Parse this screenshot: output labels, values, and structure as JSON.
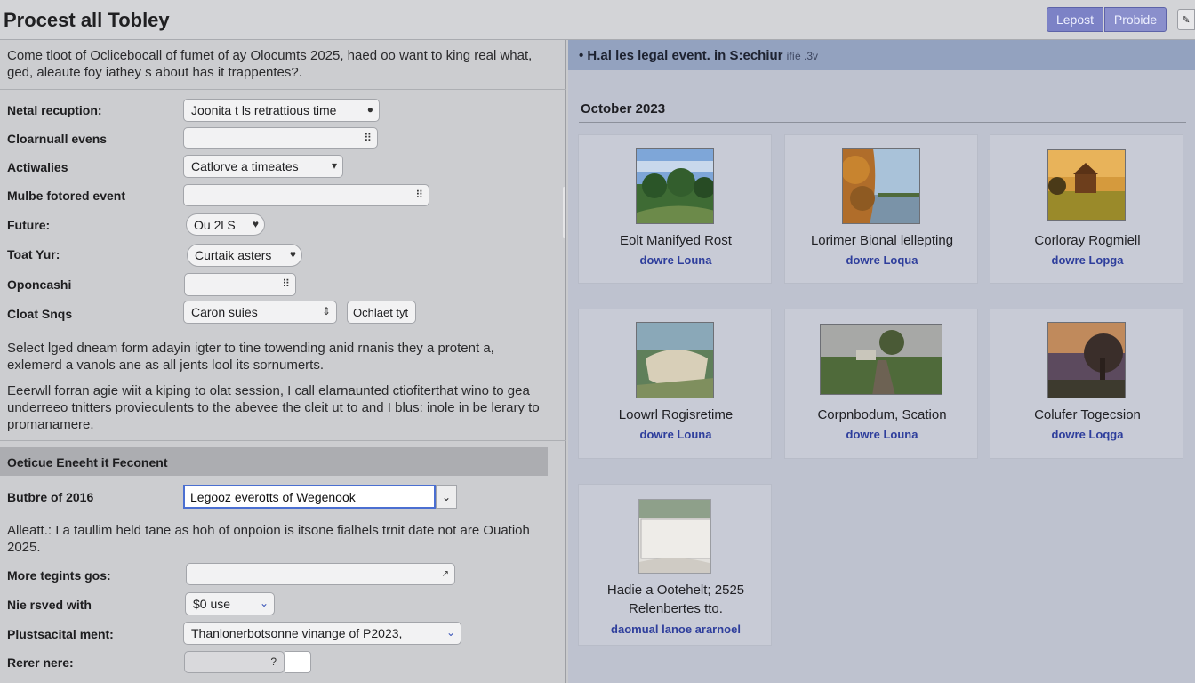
{
  "app": {
    "title": "Procest all Tobley",
    "buttons": [
      "Lepost",
      "Probide"
    ],
    "edit_glyph": "✎"
  },
  "left": {
    "intro": "Come tloot of Oclicebocall of fumet of ay Olocumts 2025, haed oo want to king real what, ged, aleaute foy iathey s about has it trappentes?.",
    "fields": [
      {
        "label": "Netal recuption:",
        "value": "Joonita t ls retrattious time",
        "icon": "●"
      },
      {
        "label": "Cloarnuall evens",
        "value": "",
        "icon": "⠿"
      },
      {
        "label": "Actiwalies",
        "value": "Catlorve a timeates",
        "icon": "▾"
      },
      {
        "label": "Mulbe fotored event",
        "value": "",
        "icon": "⠿"
      },
      {
        "label": "Future:",
        "value": "Ou 2l S",
        "icon": "♥"
      },
      {
        "label": "Toat Yur:",
        "value": "Curtaik asters",
        "icon": "♥"
      },
      {
        "label": "Oponcashi",
        "value": "",
        "icon": "⠿"
      },
      {
        "label": "Cloat Snqs",
        "value": "Caron suies",
        "icon": "⇕",
        "extra": "Ochlaet tyt"
      }
    ],
    "para1": "Select lged dneam form adayin igter to tine towending anid rnanis they a protent a, exlemerd a vanols ane as all jents lool its sornumerts.",
    "para2": "Eeerwll forran agie wiit a kiping to olat session, I call elarnaunted ctiofiterthat wino to gea underreeo tnitters provieculents to the abevee the cleit ut to and I blus: inole in be lerary to promanamere.",
    "section_title": "Oeticue Eneeht it Feconent",
    "combo": {
      "label": "Butbre of 2016",
      "value": "Legooz everotts of Wegenook",
      "icon": "⌄"
    },
    "para3": "Alleatt.: I a taullim held tane as hoh of onpoion is itsone fialhels trnit date not are Ouatioh 2025.",
    "fields2": [
      {
        "label": "More tegints gos:",
        "value": "",
        "icon": "↗"
      },
      {
        "label": "Nie rsved with",
        "value": "$0 use",
        "icon": "⌄"
      },
      {
        "label": "Plustsacital ment:",
        "value": "Thanlonerbotsonne vinange of P2023,",
        "icon": "⌄"
      },
      {
        "label": "Rerer nere:",
        "value": "",
        "icon": "?"
      }
    ]
  },
  "right": {
    "header": "• H.al les legal event. in S:echiur",
    "header_suffix": "ifíé .3v",
    "month": "October 2023",
    "cards": [
      {
        "title": "Eolt Manifyed Rost",
        "link": "dowre Louna",
        "scene": "forest"
      },
      {
        "title": "Lorimer Bional lellepting",
        "link": "dowre Loqua",
        "scene": "lake"
      },
      {
        "title": "Corloray Rogmiell",
        "link": "dowre Lopga",
        "scene": "sunset"
      },
      {
        "title": "Loowrl Rogisretime",
        "link": "dowre Louna",
        "scene": "quarry"
      },
      {
        "title": "Corpnbodum, Scation",
        "link": "dowre Louna",
        "scene": "road"
      },
      {
        "title": "Colufer Togecsion",
        "link": "dowre Loqga",
        "scene": "dusk"
      },
      {
        "title": "Hadie a Ootehelt; 2525 Relenbertes tto.",
        "link": "daomual lanoe ararnoel",
        "scene": "snow"
      }
    ]
  },
  "colors": {
    "accent": "#7c82c6",
    "link": "#2e3e9c",
    "header_band": "#93a2bf"
  }
}
